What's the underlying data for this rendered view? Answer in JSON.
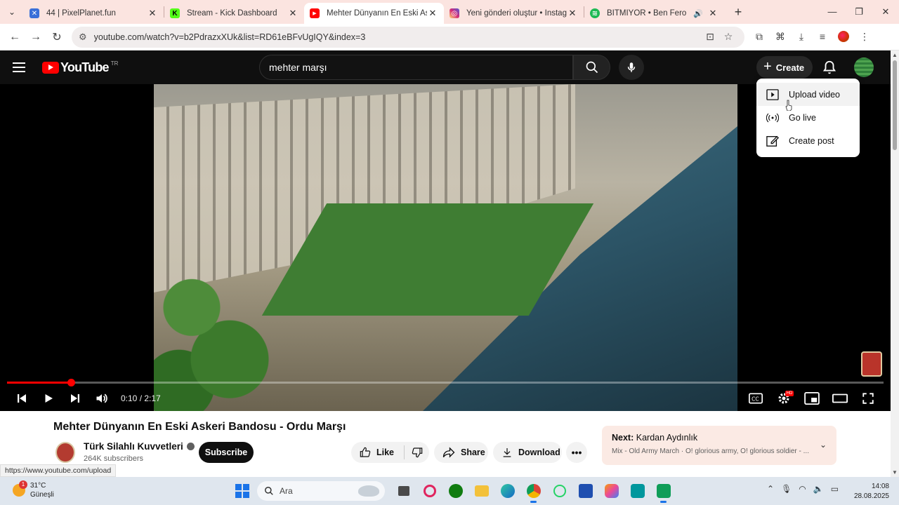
{
  "browser": {
    "tabs": [
      {
        "title": "44 | PixelPlanet.fun",
        "favicon_color": "#3a6fd8",
        "active": false
      },
      {
        "title": "Stream - Kick Dashboard",
        "favicon_color": "#53fc18",
        "active": false
      },
      {
        "title": "Mehter Dünyanın En Eski Askeri",
        "favicon_color": "#ff0000",
        "active": true
      },
      {
        "title": "Yeni gönderi oluştur • Instagram",
        "favicon_color": "#d62976",
        "active": false
      },
      {
        "title": "BİTMİYOR • Ben Fero",
        "favicon_color": "#1db954",
        "active": false
      }
    ],
    "url": "youtube.com/watch?v=b2PdrazxXUk&list=RD61eBFvUgIQY&index=3",
    "status_url": "https://www.youtube.com/upload"
  },
  "youtube": {
    "logo_text": "YouTube",
    "country_code": "TR",
    "search_value": "mehter marşı",
    "create_label": "Create",
    "create_menu": [
      {
        "label": "Upload video",
        "icon": "upload-video-icon"
      },
      {
        "label": "Go live",
        "icon": "go-live-icon"
      },
      {
        "label": "Create post",
        "icon": "create-post-icon"
      }
    ]
  },
  "player": {
    "current_time": "0:10",
    "duration": "2:17",
    "time_display": "0:10 / 2:17",
    "progress_fraction": 0.073,
    "hd_badge": "HD"
  },
  "video": {
    "title": "Mehter Dünyanın En Eski Askeri Bandosu - Ordu Marşı",
    "channel": "Türk Silahlı Kuvvetleri",
    "subscribers": "264K subscribers",
    "subscribe_label": "Subscribe",
    "like_label": "Like",
    "share_label": "Share",
    "download_label": "Download",
    "next_prefix": "Next:",
    "next_title": "Kardan Aydınlık",
    "next_sub": "Mix - Old Army March · O! glorious army, O! glorious soldier - ..."
  },
  "taskbar": {
    "weather_temp": "31°C",
    "weather_desc": "Güneşli",
    "weather_badge": "1",
    "search_placeholder": "Ara",
    "time": "14:08",
    "date": "28.08.2025"
  },
  "colors": {
    "youtube_red": "#ff0000",
    "tabstrip_bg": "#fbe4e0",
    "next_card_bg": "#fbeae4"
  }
}
